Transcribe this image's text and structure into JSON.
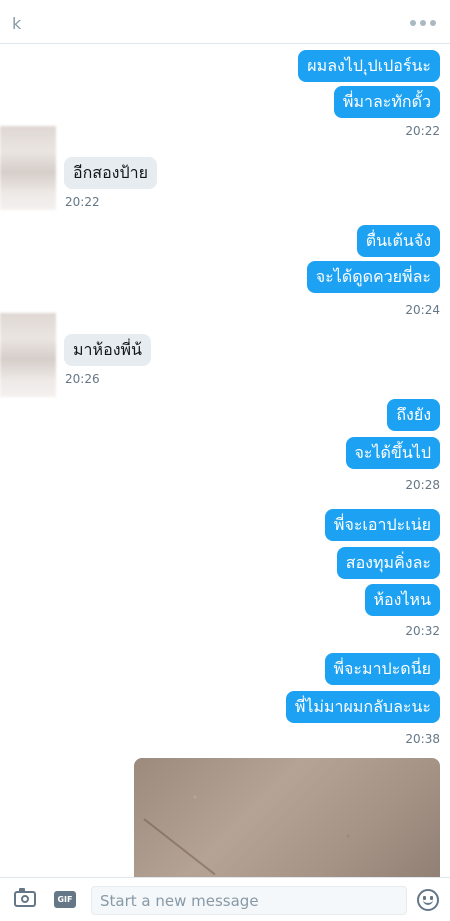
{
  "header": {
    "title": "k",
    "more_icon": "more-horizontal-icon"
  },
  "messages": [
    {
      "id": "m1",
      "side": "out",
      "text": "ผมลงไป.ุปเปอร์นะ"
    },
    {
      "id": "m2",
      "side": "out",
      "text": "พี่มาละทักดั้ว"
    },
    {
      "id": "t1",
      "side": "out",
      "time": "20:22"
    },
    {
      "id": "m3",
      "side": "in",
      "text": "อีกสองป้าย"
    },
    {
      "id": "t2",
      "side": "in",
      "time": "20:22"
    },
    {
      "id": "m4",
      "side": "out",
      "text": "ตื่นเต้นจัง"
    },
    {
      "id": "m5",
      "side": "out",
      "text": "จะได้ดูดควยพี่ละ"
    },
    {
      "id": "t3",
      "side": "out",
      "time": "20:24"
    },
    {
      "id": "m6",
      "side": "in",
      "text": "มาห้องพี่น้"
    },
    {
      "id": "t4",
      "side": "in",
      "time": "20:26"
    },
    {
      "id": "m7",
      "side": "out",
      "text": "ถึงยัง"
    },
    {
      "id": "m8",
      "side": "out",
      "text": "จะได้ขึ้นไป"
    },
    {
      "id": "t5",
      "side": "out",
      "time": "20:28"
    },
    {
      "id": "m9",
      "side": "out",
      "text": "พี่จะเอาปะเน่ย"
    },
    {
      "id": "m10",
      "side": "out",
      "text": "สองทุมคิ่งละ"
    },
    {
      "id": "m11",
      "side": "out",
      "text": "ห้องไหน"
    },
    {
      "id": "t6",
      "side": "out",
      "time": "20:32"
    },
    {
      "id": "m12",
      "side": "out",
      "text": "พี่จะมาปะดนี่ย"
    },
    {
      "id": "m13",
      "side": "out",
      "text": "พี่ไม่มาผมกลับละนะ"
    },
    {
      "id": "t7",
      "side": "out",
      "time": "20:38"
    }
  ],
  "composer": {
    "placeholder": "Start a new message",
    "value": "",
    "gif_label": "GIF",
    "camera_icon": "camera-icon",
    "emoji_icon": "emoji-icon"
  },
  "colors": {
    "outgoing_bubble": "#1da1f2",
    "incoming_bubble": "#e6ecf0",
    "timestamp": "#657786"
  }
}
